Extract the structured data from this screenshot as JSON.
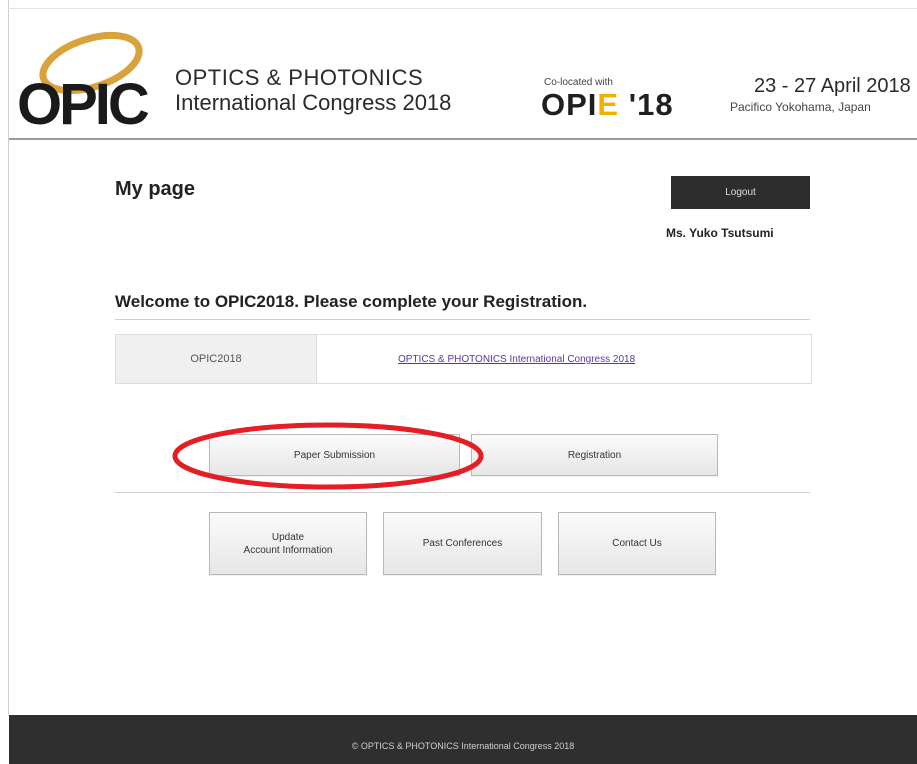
{
  "header": {
    "logo_text": "OPIC",
    "brand_line1": "OPTICS & PHOTONICS",
    "brand_line2": "International Congress 2018",
    "colocated_label": "Co-located with",
    "opie_prefix": "OPI",
    "opie_e": "E",
    "opie_suffix": " '18",
    "dates": "23 - 27 April 2018",
    "venue": "Pacifico Yokohama, Japan"
  },
  "main": {
    "page_title": "My page",
    "logout_label": "Logout",
    "user_name": "Ms. Yuko Tsutsumi",
    "welcome": "Welcome to OPIC2018. Please complete your Registration.",
    "conference": {
      "code": "OPIC2018",
      "link_text": "OPTICS & PHOTONICS International Congress 2018"
    },
    "buttons": {
      "paper_submission": "Paper Submission",
      "registration": "Registration",
      "update_line1": "Update",
      "update_line2": "Account Information",
      "past_conferences": "Past Conferences",
      "contact_us": "Contact Us"
    }
  },
  "footer": {
    "copyright": "© OPTICS & PHOTONICS International Congress 2018"
  },
  "colors": {
    "accent_logo_ring": "#d9a23a",
    "opie_e": "#f0b000",
    "highlight": "#e31e24",
    "footer_bg": "#2f2f2f",
    "logout_bg": "#2d2d2d",
    "link": "#5a35a8"
  }
}
